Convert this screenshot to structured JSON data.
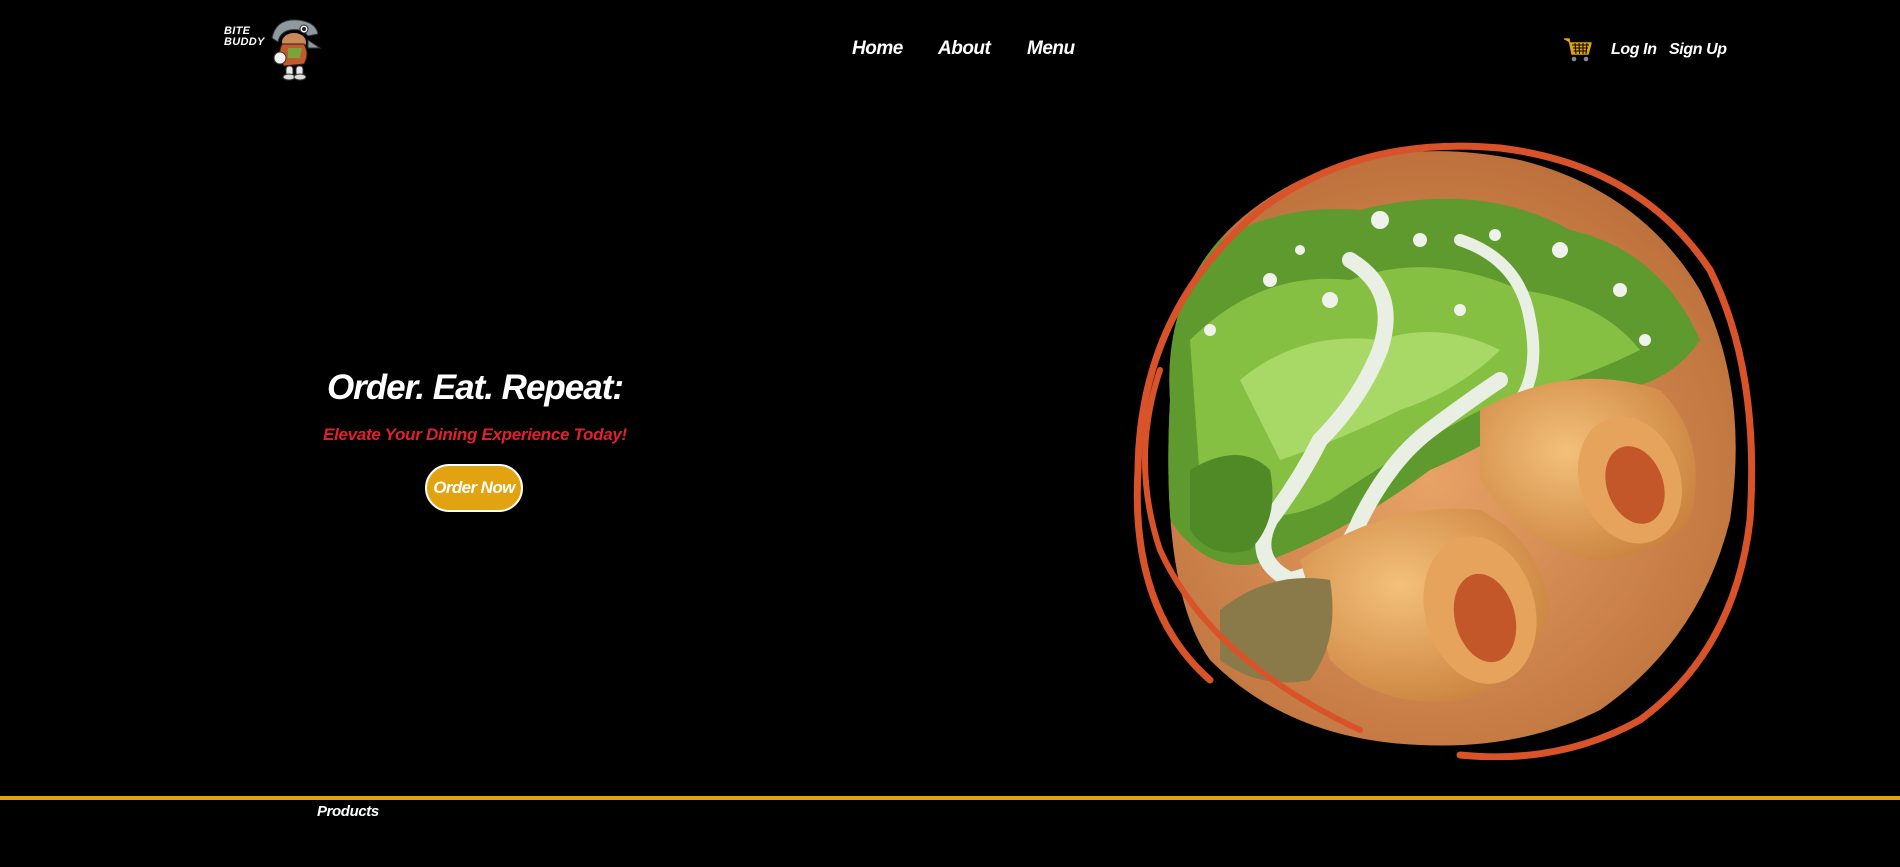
{
  "header": {
    "logo_line1": "BITE",
    "logo_line2": "BUDDY",
    "nav": [
      "Home",
      "About",
      "Menu"
    ],
    "cart_icon": "shopping-cart-icon",
    "login_label": "Log In",
    "signup_label": "Sign Up"
  },
  "hero": {
    "title": "Order. Eat. Repeat:",
    "subtitle": "Elevate Your Dining Experience Today!",
    "cta_label": "Order Now",
    "image_icon": "flautas-food-photo"
  },
  "footer": {
    "section_label": "Products"
  },
  "colors": {
    "background": "#000000",
    "accent_gold": "#e3a20f",
    "subtitle_red": "#e0212b",
    "ring_orange": "#d9532a"
  }
}
